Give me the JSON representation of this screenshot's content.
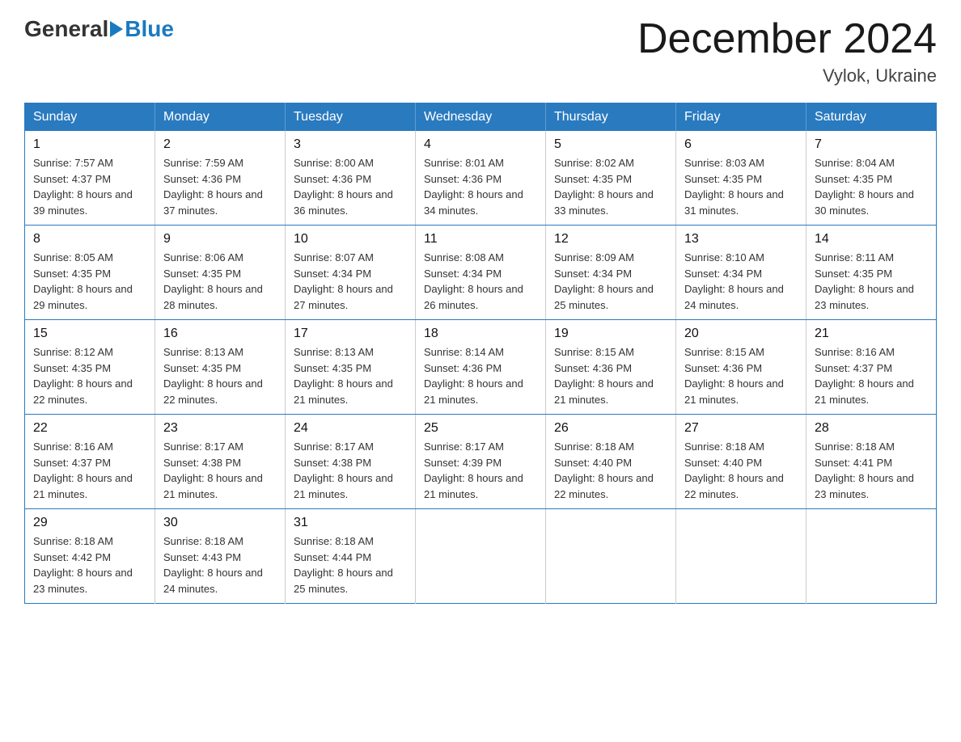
{
  "header": {
    "logo_general": "General",
    "logo_blue": "Blue",
    "month_title": "December 2024",
    "subtitle": "Vylok, Ukraine"
  },
  "days_of_week": [
    "Sunday",
    "Monday",
    "Tuesday",
    "Wednesday",
    "Thursday",
    "Friday",
    "Saturday"
  ],
  "weeks": [
    [
      {
        "day": "1",
        "sunrise": "7:57 AM",
        "sunset": "4:37 PM",
        "daylight": "8 hours and 39 minutes."
      },
      {
        "day": "2",
        "sunrise": "7:59 AM",
        "sunset": "4:36 PM",
        "daylight": "8 hours and 37 minutes."
      },
      {
        "day": "3",
        "sunrise": "8:00 AM",
        "sunset": "4:36 PM",
        "daylight": "8 hours and 36 minutes."
      },
      {
        "day": "4",
        "sunrise": "8:01 AM",
        "sunset": "4:36 PM",
        "daylight": "8 hours and 34 minutes."
      },
      {
        "day": "5",
        "sunrise": "8:02 AM",
        "sunset": "4:35 PM",
        "daylight": "8 hours and 33 minutes."
      },
      {
        "day": "6",
        "sunrise": "8:03 AM",
        "sunset": "4:35 PM",
        "daylight": "8 hours and 31 minutes."
      },
      {
        "day": "7",
        "sunrise": "8:04 AM",
        "sunset": "4:35 PM",
        "daylight": "8 hours and 30 minutes."
      }
    ],
    [
      {
        "day": "8",
        "sunrise": "8:05 AM",
        "sunset": "4:35 PM",
        "daylight": "8 hours and 29 minutes."
      },
      {
        "day": "9",
        "sunrise": "8:06 AM",
        "sunset": "4:35 PM",
        "daylight": "8 hours and 28 minutes."
      },
      {
        "day": "10",
        "sunrise": "8:07 AM",
        "sunset": "4:34 PM",
        "daylight": "8 hours and 27 minutes."
      },
      {
        "day": "11",
        "sunrise": "8:08 AM",
        "sunset": "4:34 PM",
        "daylight": "8 hours and 26 minutes."
      },
      {
        "day": "12",
        "sunrise": "8:09 AM",
        "sunset": "4:34 PM",
        "daylight": "8 hours and 25 minutes."
      },
      {
        "day": "13",
        "sunrise": "8:10 AM",
        "sunset": "4:34 PM",
        "daylight": "8 hours and 24 minutes."
      },
      {
        "day": "14",
        "sunrise": "8:11 AM",
        "sunset": "4:35 PM",
        "daylight": "8 hours and 23 minutes."
      }
    ],
    [
      {
        "day": "15",
        "sunrise": "8:12 AM",
        "sunset": "4:35 PM",
        "daylight": "8 hours and 22 minutes."
      },
      {
        "day": "16",
        "sunrise": "8:13 AM",
        "sunset": "4:35 PM",
        "daylight": "8 hours and 22 minutes."
      },
      {
        "day": "17",
        "sunrise": "8:13 AM",
        "sunset": "4:35 PM",
        "daylight": "8 hours and 21 minutes."
      },
      {
        "day": "18",
        "sunrise": "8:14 AM",
        "sunset": "4:36 PM",
        "daylight": "8 hours and 21 minutes."
      },
      {
        "day": "19",
        "sunrise": "8:15 AM",
        "sunset": "4:36 PM",
        "daylight": "8 hours and 21 minutes."
      },
      {
        "day": "20",
        "sunrise": "8:15 AM",
        "sunset": "4:36 PM",
        "daylight": "8 hours and 21 minutes."
      },
      {
        "day": "21",
        "sunrise": "8:16 AM",
        "sunset": "4:37 PM",
        "daylight": "8 hours and 21 minutes."
      }
    ],
    [
      {
        "day": "22",
        "sunrise": "8:16 AM",
        "sunset": "4:37 PM",
        "daylight": "8 hours and 21 minutes."
      },
      {
        "day": "23",
        "sunrise": "8:17 AM",
        "sunset": "4:38 PM",
        "daylight": "8 hours and 21 minutes."
      },
      {
        "day": "24",
        "sunrise": "8:17 AM",
        "sunset": "4:38 PM",
        "daylight": "8 hours and 21 minutes."
      },
      {
        "day": "25",
        "sunrise": "8:17 AM",
        "sunset": "4:39 PM",
        "daylight": "8 hours and 21 minutes."
      },
      {
        "day": "26",
        "sunrise": "8:18 AM",
        "sunset": "4:40 PM",
        "daylight": "8 hours and 22 minutes."
      },
      {
        "day": "27",
        "sunrise": "8:18 AM",
        "sunset": "4:40 PM",
        "daylight": "8 hours and 22 minutes."
      },
      {
        "day": "28",
        "sunrise": "8:18 AM",
        "sunset": "4:41 PM",
        "daylight": "8 hours and 23 minutes."
      }
    ],
    [
      {
        "day": "29",
        "sunrise": "8:18 AM",
        "sunset": "4:42 PM",
        "daylight": "8 hours and 23 minutes."
      },
      {
        "day": "30",
        "sunrise": "8:18 AM",
        "sunset": "4:43 PM",
        "daylight": "8 hours and 24 minutes."
      },
      {
        "day": "31",
        "sunrise": "8:18 AM",
        "sunset": "4:44 PM",
        "daylight": "8 hours and 25 minutes."
      },
      null,
      null,
      null,
      null
    ]
  ],
  "labels": {
    "sunrise_prefix": "Sunrise: ",
    "sunset_prefix": "Sunset: ",
    "daylight_prefix": "Daylight: "
  }
}
